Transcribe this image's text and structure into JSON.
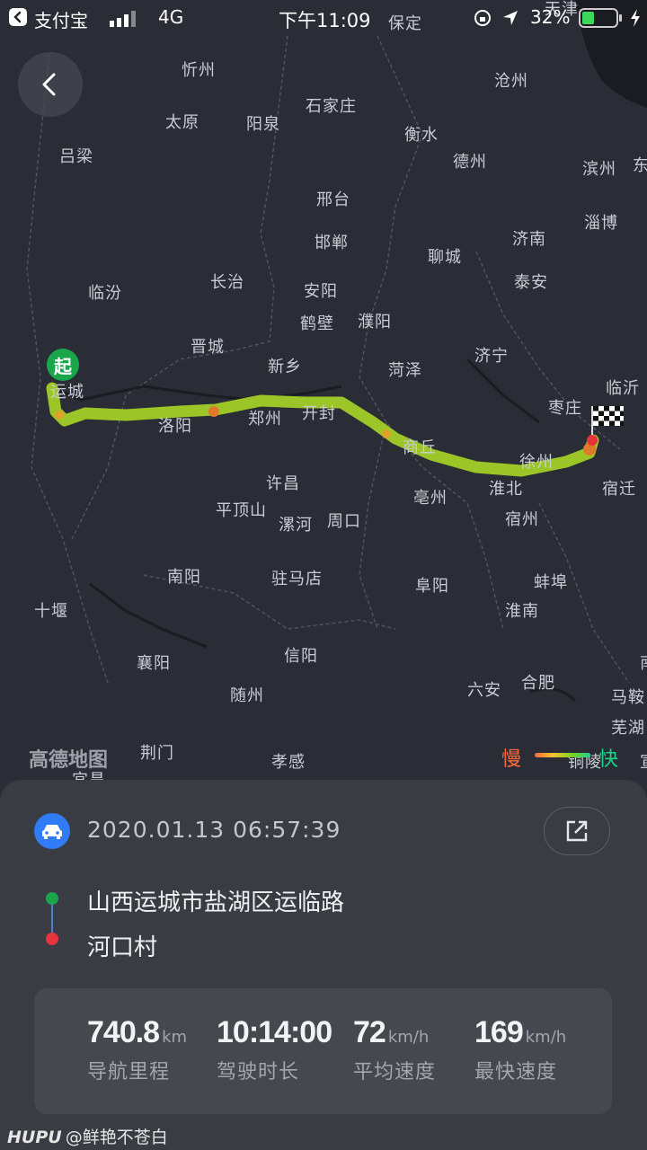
{
  "status_bar": {
    "back_app": "支付宝",
    "network": "4G",
    "time": "下午11:09",
    "battery": "32%"
  },
  "map": {
    "provider_logo": "高德地图",
    "legend": {
      "slow": "慢",
      "fast": "快"
    },
    "start_marker": "起",
    "cities": [
      "忻州",
      "石家庄",
      "沧州",
      "太原",
      "阳泉",
      "吕梁",
      "衡水",
      "德州",
      "滨州",
      "淄博",
      "邢台",
      "济南",
      "邯郸",
      "聊城",
      "临汾",
      "长治",
      "安阳",
      "泰安",
      "鹤壁",
      "濮阳",
      "晋城",
      "济宁",
      "新乡",
      "菏泽",
      "临沂",
      "运城",
      "枣庄",
      "洛阳",
      "郑州",
      "开封",
      "商丘",
      "徐州",
      "宿迁",
      "亳州",
      "淮北",
      "许昌",
      "平顶山",
      "漯河",
      "周口",
      "宿州",
      "南阳",
      "驻马店",
      "蚌埠",
      "阜阳",
      "十堰",
      "淮南",
      "信阳",
      "襄阳",
      "六安",
      "合肥",
      "随州",
      "马鞍",
      "芜湖",
      "荆门",
      "孝感",
      "铜陵",
      "保定",
      "天津",
      "东",
      "宜昌",
      "南",
      "宣"
    ]
  },
  "trip": {
    "timestamp": "2020.01.13 06:57:39",
    "start_address": "山西运城市盐湖区运临路",
    "end_address": "河口村",
    "colors": {
      "start": "#1aa64b",
      "end": "#e8323c",
      "accent": "#2f7cf6"
    }
  },
  "stats": [
    {
      "value": "740.8",
      "unit": "km",
      "label": "导航里程"
    },
    {
      "value": "10:14:00",
      "unit": "",
      "label": "驾驶时长"
    },
    {
      "value": "72",
      "unit": "km/h",
      "label": "平均速度"
    },
    {
      "value": "169",
      "unit": "km/h",
      "label": "最快速度"
    }
  ],
  "watermark": {
    "brand": "HUPU",
    "user": "@鲜艳不苍白"
  }
}
